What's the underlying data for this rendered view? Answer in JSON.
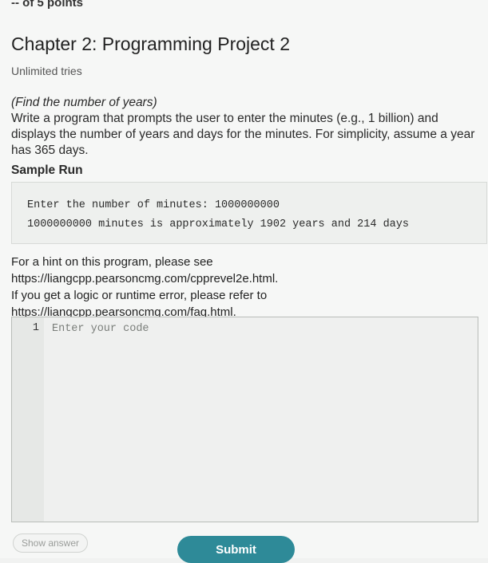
{
  "header": {
    "points": "-- of 5 points",
    "title": "Chapter 2: Programming Project 2",
    "tries": "Unlimited tries"
  },
  "problem": {
    "heading": "(Find the number of years)",
    "description": "Write a program that prompts the user to enter the minutes (e.g., 1 billion) and displays the number of years and days for the minutes. For simplicity, assume a year has 365 days.",
    "sample_label": "Sample Run",
    "sample_lines": [
      "Enter the number of minutes: 1000000000",
      "1000000000 minutes is approximately 1902 years and 214 days"
    ]
  },
  "hints": {
    "line1": "For a hint on this program, please see",
    "line2": "https://liangcpp.pearsoncmg.com/cpprevel2e.html.",
    "line3": "If you get a logic or runtime error, please refer to",
    "line4": "https://liangcpp.pearsoncmg.com/faq.html."
  },
  "editor": {
    "line_number": "1",
    "placeholder": "Enter your code"
  },
  "actions": {
    "show_answer": "Show answer",
    "submit": "Submit"
  },
  "colors": {
    "submit_bg": "#2e8a98",
    "page_bg": "#f6f7f6"
  }
}
